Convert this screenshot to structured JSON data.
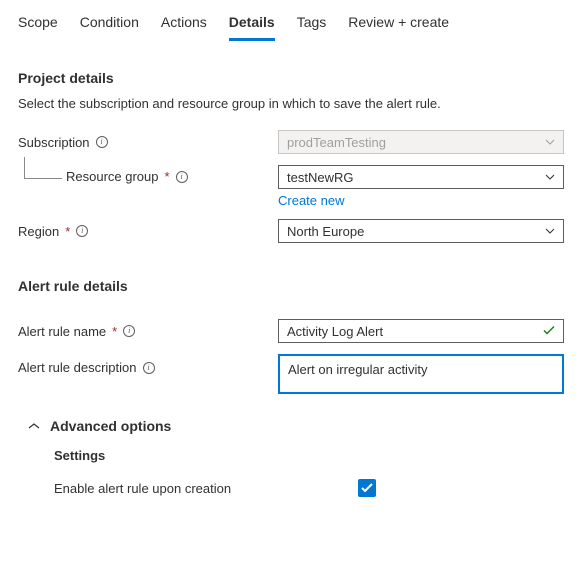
{
  "tabs": {
    "scope": "Scope",
    "condition": "Condition",
    "actions": "Actions",
    "details": "Details",
    "tags": "Tags",
    "review": "Review + create"
  },
  "project": {
    "title": "Project details",
    "desc": "Select the subscription and resource group in which to save the alert rule.",
    "subscription_label": "Subscription",
    "subscription_value": "prodTeamTesting",
    "rg_label": "Resource group",
    "rg_value": "testNewRG",
    "create_new": "Create new",
    "region_label": "Region",
    "region_value": "North Europe"
  },
  "rule": {
    "title": "Alert rule details",
    "name_label": "Alert rule name",
    "name_value": "Activity Log Alert",
    "desc_label": "Alert rule description",
    "desc_value": "Alert on irregular activity"
  },
  "advanced": {
    "title": "Advanced options",
    "settings": "Settings",
    "enable_label": "Enable alert rule upon creation",
    "enable_checked": true
  }
}
